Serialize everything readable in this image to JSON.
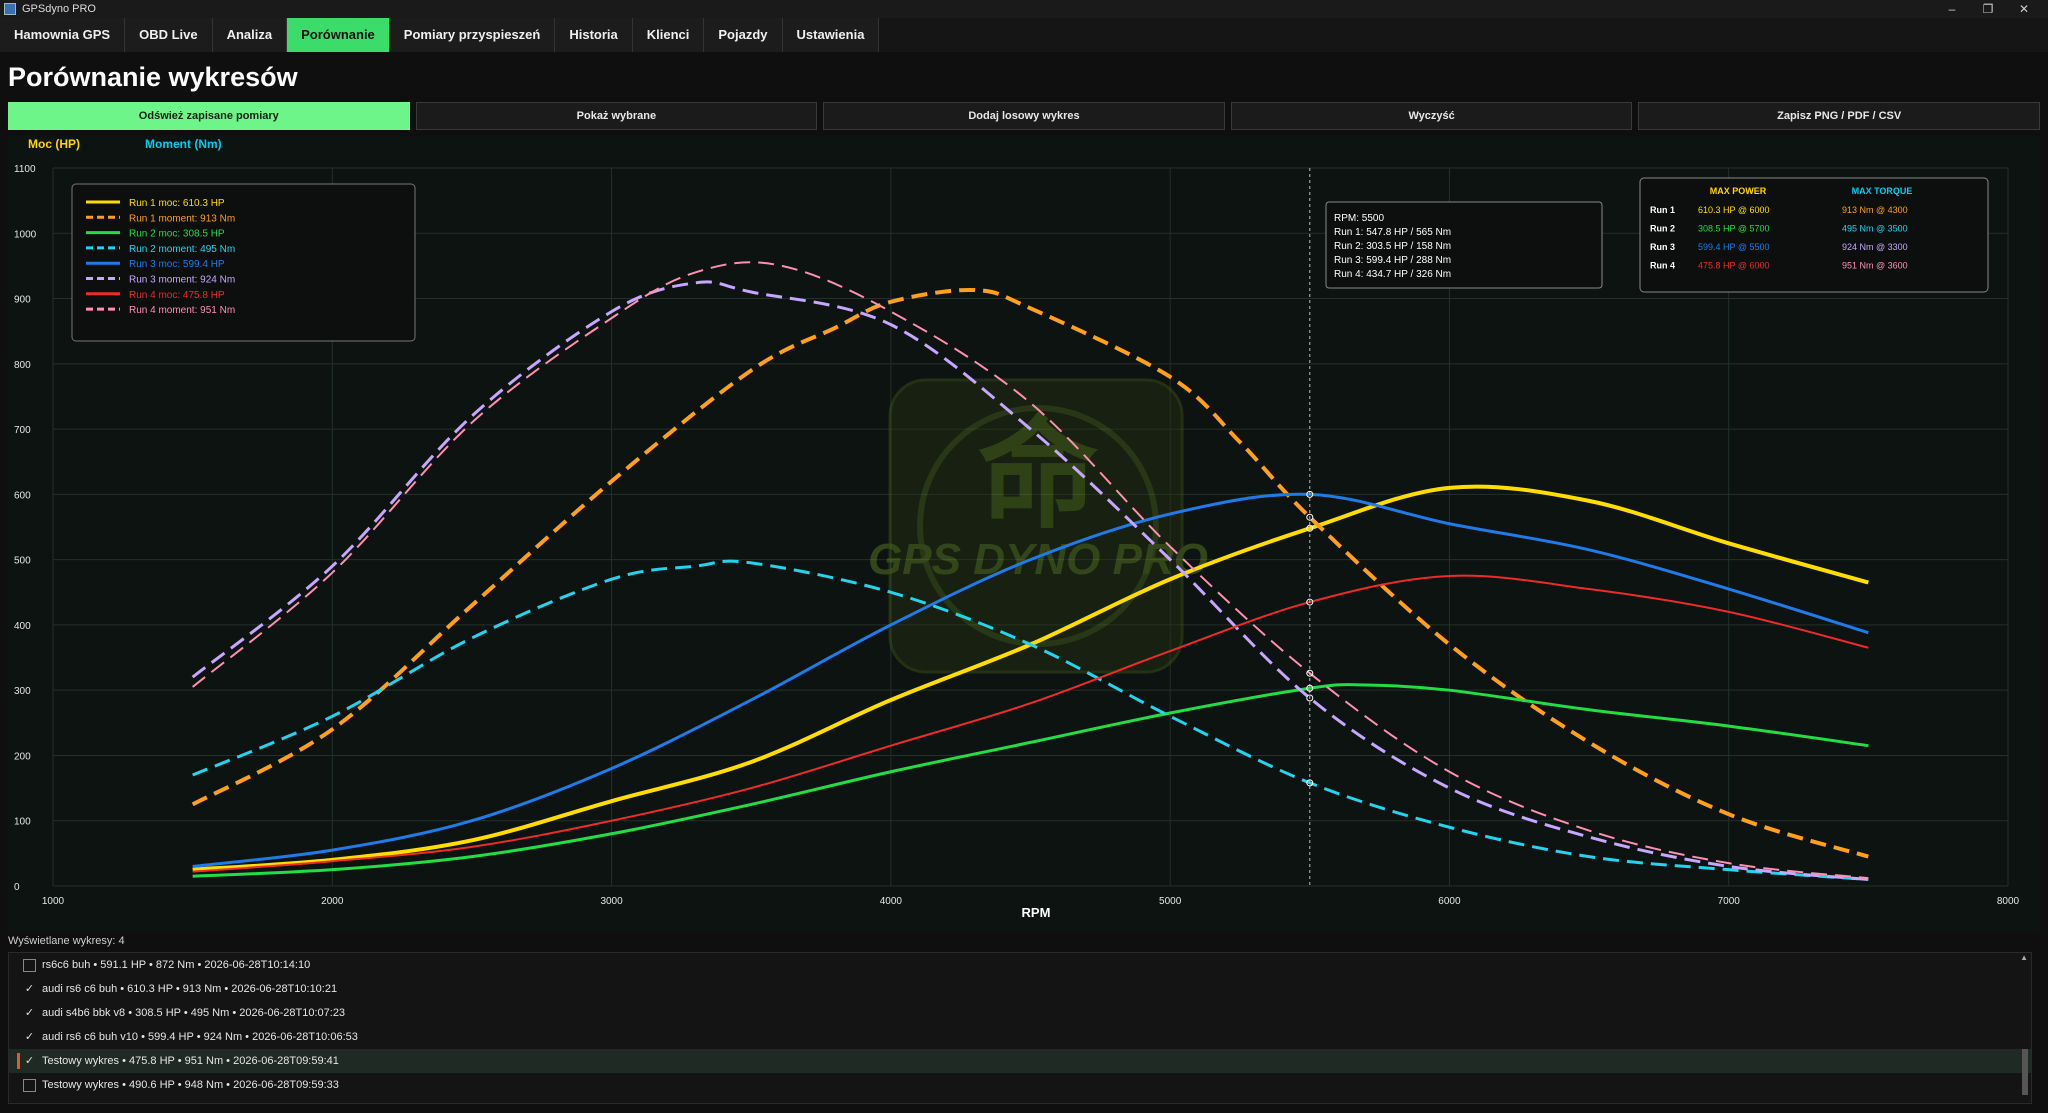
{
  "window": {
    "title": "GPSdyno PRO",
    "controls": [
      "–",
      "❐",
      "✕"
    ]
  },
  "tabs": [
    {
      "label": "Hamownia GPS",
      "active": false
    },
    {
      "label": "OBD Live",
      "active": false
    },
    {
      "label": "Analiza",
      "active": false
    },
    {
      "label": "Porównanie",
      "active": true
    },
    {
      "label": "Pomiary przyspieszeń",
      "active": false
    },
    {
      "label": "Historia",
      "active": false
    },
    {
      "label": "Klienci",
      "active": false
    },
    {
      "label": "Pojazdy",
      "active": false
    },
    {
      "label": "Ustawienia",
      "active": false
    }
  ],
  "page_title": "Porównanie wykresów",
  "actions": {
    "refresh": "Odśwież zapisane pomiary",
    "show_selected": "Pokaż wybrane",
    "add_random": "Dodaj losowy wykres",
    "clear": "Wyczyść",
    "save": "Zapisz PNG / PDF / CSV"
  },
  "colors": {
    "accent": "#3bdc6a",
    "power_label": "#ffd400",
    "torque_label": "#00ccf0"
  },
  "chart_data": {
    "type": "line",
    "xlabel": "RPM",
    "axis_titles": {
      "power": "Moc (HP)",
      "torque": "Moment (Nm)"
    },
    "xlim": [
      1000,
      8000
    ],
    "ylim": [
      0,
      1100
    ],
    "x_ticks": [
      1000,
      2000,
      3000,
      4000,
      5000,
      6000,
      7000,
      8000
    ],
    "y_ticks": [
      0,
      100,
      200,
      300,
      400,
      500,
      600,
      700,
      800,
      900,
      1000,
      1100
    ],
    "grid": true,
    "cursor_rpm": 5500,
    "watermark": "GPS DYNO PRO",
    "series": [
      {
        "name": "Run 1 moc: 610.3 HP",
        "color": "#ffdd00",
        "dash": false,
        "width": 4,
        "x": [
          1500,
          2000,
          2500,
          3000,
          3500,
          4000,
          4500,
          5000,
          5500,
          6000,
          6500,
          7000,
          7500
        ],
        "y": [
          25,
          40,
          70,
          130,
          190,
          285,
          370,
          470,
          548,
          610,
          590,
          525,
          465
        ]
      },
      {
        "name": "Run 1 moment: 913 Nm",
        "color": "#ff9f1a",
        "dash": true,
        "width": 4,
        "x": [
          1500,
          2000,
          2500,
          3000,
          3500,
          3800,
          4000,
          4300,
          4500,
          5000,
          5250,
          5500,
          6000,
          6500,
          7000,
          7500
        ],
        "y": [
          125,
          240,
          430,
          620,
          790,
          855,
          895,
          913,
          885,
          780,
          680,
          565,
          370,
          220,
          110,
          45
        ]
      },
      {
        "name": "Run 2 moc: 308.5 HP",
        "color": "#22dd44",
        "dash": false,
        "width": 3,
        "x": [
          1500,
          2000,
          2500,
          3000,
          3500,
          4000,
          4500,
          5000,
          5500,
          5700,
          6000,
          6500,
          7000,
          7500
        ],
        "y": [
          15,
          25,
          45,
          80,
          125,
          175,
          220,
          265,
          303,
          308,
          300,
          270,
          245,
          215
        ]
      },
      {
        "name": "Run 2 moment: 495 Nm",
        "color": "#22d4ee",
        "dash": true,
        "width": 3,
        "x": [
          1500,
          2000,
          2500,
          3000,
          3300,
          3500,
          4000,
          4500,
          5000,
          5500,
          6000,
          6500,
          7000,
          7500
        ],
        "y": [
          170,
          260,
          380,
          470,
          490,
          495,
          450,
          370,
          260,
          158,
          90,
          45,
          25,
          10
        ]
      },
      {
        "name": "Run 3 moc: 599.4 HP",
        "color": "#1e7be8",
        "dash": false,
        "width": 3,
        "x": [
          1500,
          2000,
          2500,
          3000,
          3500,
          4000,
          4500,
          5000,
          5500,
          6000,
          6500,
          7000,
          7500
        ],
        "y": [
          30,
          55,
          100,
          180,
          285,
          400,
          500,
          570,
          600,
          555,
          515,
          455,
          388
        ]
      },
      {
        "name": "Run 3 moment: 924 Nm",
        "color": "#c7a6ff",
        "dash": true,
        "width": 3,
        "x": [
          1500,
          2000,
          2500,
          3000,
          3300,
          3500,
          4000,
          4500,
          5000,
          5500,
          6000,
          6500,
          7000,
          7500
        ],
        "y": [
          320,
          490,
          720,
          880,
          924,
          910,
          860,
          700,
          500,
          288,
          150,
          75,
          30,
          10
        ]
      },
      {
        "name": "Run 4 moc: 475.8 HP",
        "color": "#ee2b2b",
        "dash": false,
        "width": 2,
        "x": [
          1500,
          2000,
          2500,
          3000,
          3500,
          4000,
          4500,
          5000,
          5500,
          6000,
          6500,
          7000,
          7500
        ],
        "y": [
          22,
          38,
          60,
          100,
          150,
          215,
          280,
          360,
          435,
          475,
          455,
          420,
          365
        ]
      },
      {
        "name": "Run 4 moment: 951 Nm",
        "color": "#ff8fb0",
        "dash": true,
        "width": 2,
        "x": [
          1500,
          2000,
          2500,
          3000,
          3300,
          3600,
          4000,
          4500,
          5000,
          5500,
          6000,
          6500,
          7000,
          7500
        ],
        "y": [
          305,
          480,
          710,
          870,
          940,
          951,
          880,
          740,
          520,
          326,
          175,
          85,
          35,
          12
        ]
      }
    ]
  },
  "cursor_box": {
    "title": "RPM: 5500",
    "lines": [
      "Run 1: 547.8 HP / 565 Nm",
      "Run 2: 303.5 HP / 158 Nm",
      "Run 3: 599.4 HP / 288 Nm",
      "Run 4: 434.7 HP / 326 Nm"
    ]
  },
  "max_table": {
    "power_header": "MAX POWER",
    "torque_header": "MAX TORQUE",
    "rows": [
      {
        "run": "Run 1",
        "power": "610.3 HP @ 6000",
        "torque": "913 Nm @ 4300",
        "power_color": "#ffdd00",
        "torque_color": "#ff9f1a"
      },
      {
        "run": "Run 2",
        "power": "308.5 HP @ 5700",
        "torque": "495 Nm @ 3500",
        "power_color": "#22dd44",
        "torque_color": "#22d4ee"
      },
      {
        "run": "Run 3",
        "power": "599.4 HP @ 5500",
        "torque": "924 Nm @ 3300",
        "power_color": "#1e7be8",
        "torque_color": "#c7a6ff"
      },
      {
        "run": "Run 4",
        "power": "475.8 HP @ 6000",
        "torque": "951 Nm @ 3600",
        "power_color": "#ee2b2b",
        "torque_color": "#ff8fb0"
      }
    ]
  },
  "shown_count": "Wyświetlane wykresy: 4",
  "measurements": [
    {
      "label": "rs6c6 buh • 591.1 HP • 872 Nm • 2026-06-28T10:14:10",
      "checked": false,
      "selected": false
    },
    {
      "label": "audi rs6 c6 buh • 610.3 HP • 913 Nm • 2026-06-28T10:10:21",
      "checked": true,
      "selected": false
    },
    {
      "label": "audi s4b6 bbk v8 • 308.5 HP • 495 Nm • 2026-06-28T10:07:23",
      "checked": true,
      "selected": false
    },
    {
      "label": "audi rs6 c6 buh v10 • 599.4 HP • 924 Nm • 2026-06-28T10:06:53",
      "checked": true,
      "selected": false
    },
    {
      "label": "Testowy wykres • 475.8 HP • 951 Nm • 2026-06-28T09:59:41",
      "checked": true,
      "selected": true
    },
    {
      "label": "Testowy wykres • 490.6 HP • 948 Nm • 2026-06-28T09:59:33",
      "checked": false,
      "selected": false
    }
  ]
}
